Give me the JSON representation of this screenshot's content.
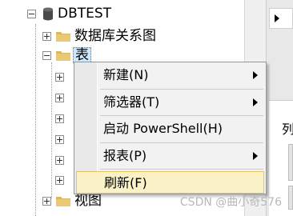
{
  "tree": {
    "database": "DBTEST",
    "items": [
      {
        "label": "数据库关系图"
      },
      {
        "label": "表"
      },
      {
        "label": "视图"
      }
    ]
  },
  "context_menu": {
    "items": [
      {
        "label": "新建(N)",
        "submenu": true
      },
      {
        "label": "筛选器(T)",
        "submenu": true
      },
      {
        "label": "启动 PowerShell(H)",
        "submenu": false
      },
      {
        "label": "报表(P)",
        "submenu": true
      },
      {
        "label": "刷新(F)",
        "submenu": false,
        "highlighted": true
      }
    ]
  },
  "right_panel": {
    "tab_label": "列"
  },
  "watermark": "CSDN @曲小奇576",
  "colors": {
    "selection": "#cce8ff",
    "menu_highlight": "#fbf2c7",
    "folder": "#dcb85a"
  }
}
